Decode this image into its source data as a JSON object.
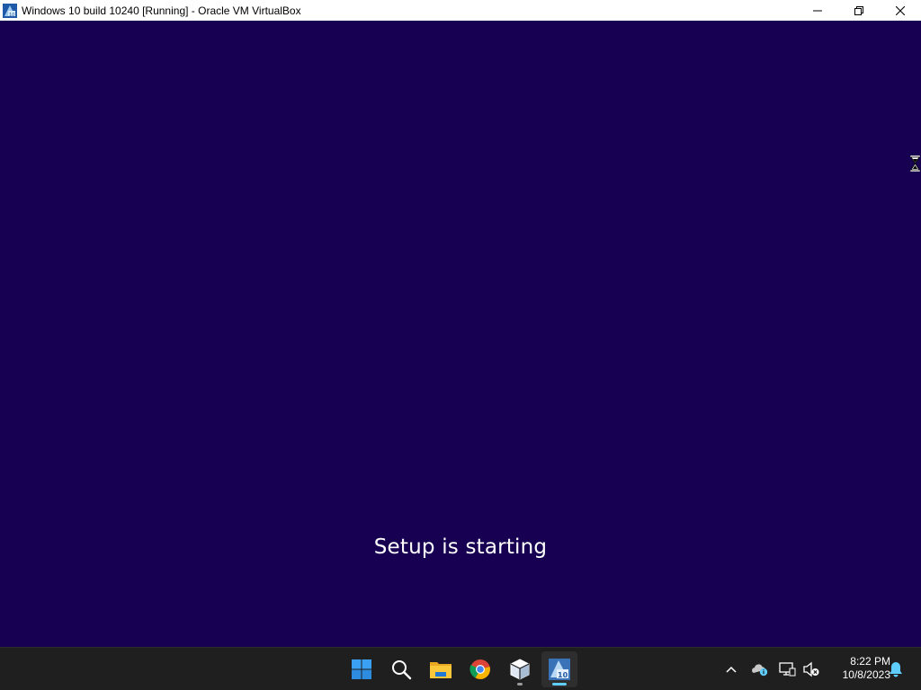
{
  "window": {
    "title": "Windows 10 build 10240 [Running] - Oracle VM VirtualBox",
    "controls": {
      "minimize": "minimize",
      "restore": "restore",
      "close": "close"
    }
  },
  "vm": {
    "background_color": "#170052",
    "message": "Setup is starting"
  },
  "taskbar": {
    "pinned": [
      {
        "name": "start-button",
        "icon": "windows-logo-icon"
      },
      {
        "name": "search-button",
        "icon": "search-icon"
      },
      {
        "name": "file-explorer",
        "icon": "folder-icon"
      },
      {
        "name": "chrome",
        "icon": "chrome-icon"
      },
      {
        "name": "virtualbox-manager",
        "icon": "virtualbox-icon"
      },
      {
        "name": "virtualbox-vm-window",
        "icon": "virtualbox-vm-icon"
      }
    ],
    "tray": {
      "time": "8:22 PM",
      "date": "10/8/2023"
    }
  },
  "colors": {
    "accent": "#60cdff",
    "taskbar": "#1f1f1f"
  }
}
